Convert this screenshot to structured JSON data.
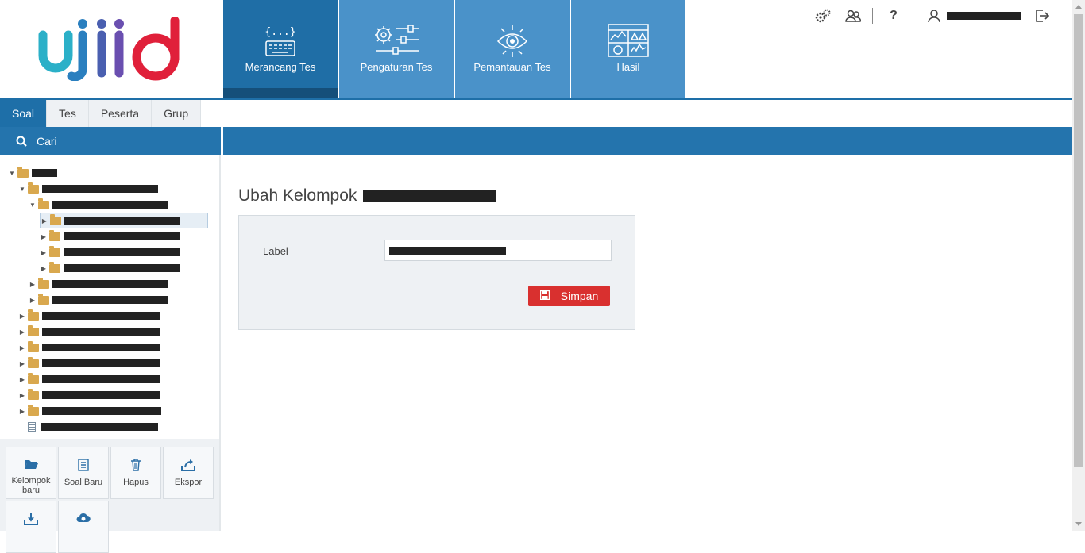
{
  "header": {
    "logo_text": "ujiid",
    "nav": [
      {
        "label": "Merancang Tes",
        "icon": "code-keyboard-icon",
        "active": true
      },
      {
        "label": "Pengaturan Tes",
        "icon": "settings-sliders-icon",
        "active": false
      },
      {
        "label": "Pemantauan Tes",
        "icon": "eye-monitor-icon",
        "active": false
      },
      {
        "label": "Hasil",
        "icon": "dashboard-chart-icon",
        "active": false
      }
    ],
    "top_icons": [
      "gears-icon",
      "users-icon",
      "help-icon",
      "user-icon",
      "logout-icon"
    ],
    "help_label": "?"
  },
  "subtabs": [
    "Soal",
    "Tes",
    "Peserta",
    "Grup"
  ],
  "search": {
    "label": "Cari"
  },
  "toolbox": [
    {
      "label": "Kelompok baru",
      "icon": "folder-open-icon"
    },
    {
      "label": "Soal Baru",
      "icon": "question-doc-icon"
    },
    {
      "label": "Hapus",
      "icon": "trash-icon"
    },
    {
      "label": "Ekspor",
      "icon": "export-icon"
    },
    {
      "label": "",
      "icon": "import-icon"
    },
    {
      "label": "",
      "icon": "cloud-icon"
    }
  ],
  "content": {
    "title": "Ubah Kelompok",
    "field_label": "Label",
    "save_label": "Simpan"
  },
  "colors": {
    "primary": "#1e6fa8",
    "nav": "#4a92c9",
    "danger": "#d9302f",
    "folder": "#d9a84e"
  }
}
